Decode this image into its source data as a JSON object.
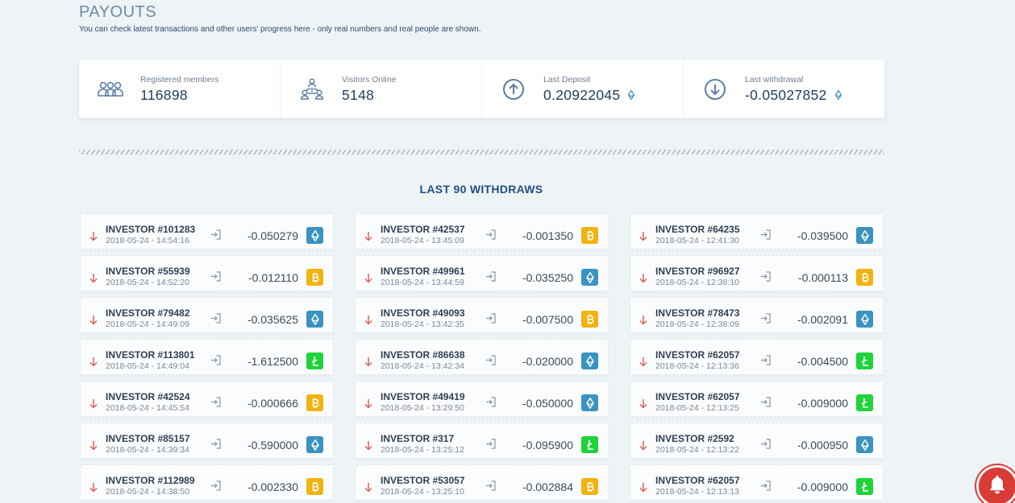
{
  "header": {
    "title": "PAYOUTS",
    "subtitle": "You can check latest transactions and other users' progress here - only real numbers and real people are shown."
  },
  "stats": [
    {
      "label": "Registered members",
      "value": "116898",
      "icon": "members-icon"
    },
    {
      "label": "Visitors Online",
      "value": "5148",
      "icon": "network-icon"
    },
    {
      "label": "Last Deposit",
      "value": "0.20922045",
      "icon": "arrow-up-circle-icon",
      "currency_icon": "eth-icon"
    },
    {
      "label": "Last withdrawal",
      "value": "-0.05027852",
      "icon": "arrow-down-circle-icon",
      "currency_icon": "eth-icon"
    }
  ],
  "withdraws": {
    "title": "LAST 90 WITHDRAWS",
    "columns": [
      [
        {
          "investor": "INVESTOR #101283",
          "date": "2018-05-24 - 14:54:16",
          "amount": "-0.050279",
          "coin": "eth"
        },
        {
          "investor": "INVESTOR #55939",
          "date": "2018-05-24 - 14:52:20",
          "amount": "-0.012110",
          "coin": "btc"
        },
        {
          "investor": "INVESTOR #79482",
          "date": "2018-05-24 - 14:49:09",
          "amount": "-0.035625",
          "coin": "eth"
        },
        {
          "investor": "INVESTOR #113801",
          "date": "2018-05-24 - 14:49:04",
          "amount": "-1.612500",
          "coin": "ltc"
        },
        {
          "investor": "INVESTOR #42524",
          "date": "2018-05-24 - 14:45:54",
          "amount": "-0.000666",
          "coin": "btc"
        },
        {
          "investor": "INVESTOR #85157",
          "date": "2018-05-24 - 14:39:34",
          "amount": "-0.590000",
          "coin": "eth"
        },
        {
          "investor": "INVESTOR #112989",
          "date": "2018-05-24 - 14:38:50",
          "amount": "-0.002330",
          "coin": "btc"
        }
      ],
      [
        {
          "investor": "INVESTOR #42537",
          "date": "2018-05-24 - 13:45:09",
          "amount": "-0.001350",
          "coin": "btc"
        },
        {
          "investor": "INVESTOR #49961",
          "date": "2018-05-24 - 13:44:59",
          "amount": "-0.035250",
          "coin": "eth"
        },
        {
          "investor": "INVESTOR #49093",
          "date": "2018-05-24 - 13:42:35",
          "amount": "-0.007500",
          "coin": "btc"
        },
        {
          "investor": "INVESTOR #86638",
          "date": "2018-05-24 - 13:42:34",
          "amount": "-0.020000",
          "coin": "eth"
        },
        {
          "investor": "INVESTOR #49419",
          "date": "2018-05-24 - 13:29:50",
          "amount": "-0.050000",
          "coin": "eth"
        },
        {
          "investor": "INVESTOR #317",
          "date": "2018-05-24 - 13:25:12",
          "amount": "-0.095900",
          "coin": "ltc"
        },
        {
          "investor": "INVESTOR #53057",
          "date": "2018-05-24 - 13:25:10",
          "amount": "-0.002884",
          "coin": "btc"
        }
      ],
      [
        {
          "investor": "INVESTOR #64235",
          "date": "2018-05-24 - 12:41:30",
          "amount": "-0.039500",
          "coin": "eth"
        },
        {
          "investor": "INVESTOR #96927",
          "date": "2018-05-24 - 12:38:10",
          "amount": "-0.000113",
          "coin": "btc"
        },
        {
          "investor": "INVESTOR #78473",
          "date": "2018-05-24 - 12:38:09",
          "amount": "-0.002091",
          "coin": "eth"
        },
        {
          "investor": "INVESTOR #62057",
          "date": "2018-05-24 - 12:13:36",
          "amount": "-0.004500",
          "coin": "ltc"
        },
        {
          "investor": "INVESTOR #62057",
          "date": "2018-05-24 - 12:13:25",
          "amount": "-0.009000",
          "coin": "ltc"
        },
        {
          "investor": "INVESTOR #2592",
          "date": "2018-05-24 - 12:13:22",
          "amount": "-0.000950",
          "coin": "eth"
        },
        {
          "investor": "INVESTOR #62057",
          "date": "2018-05-24 - 12:13:13",
          "amount": "-0.009000",
          "coin": "ltc"
        }
      ]
    ]
  },
  "colors": {
    "background": "#eef3f6",
    "eth": "#3a93c0",
    "btc": "#f2b311",
    "ltc": "#1fd33a",
    "arrow": "#e0605a",
    "notification": "#d93b35"
  }
}
